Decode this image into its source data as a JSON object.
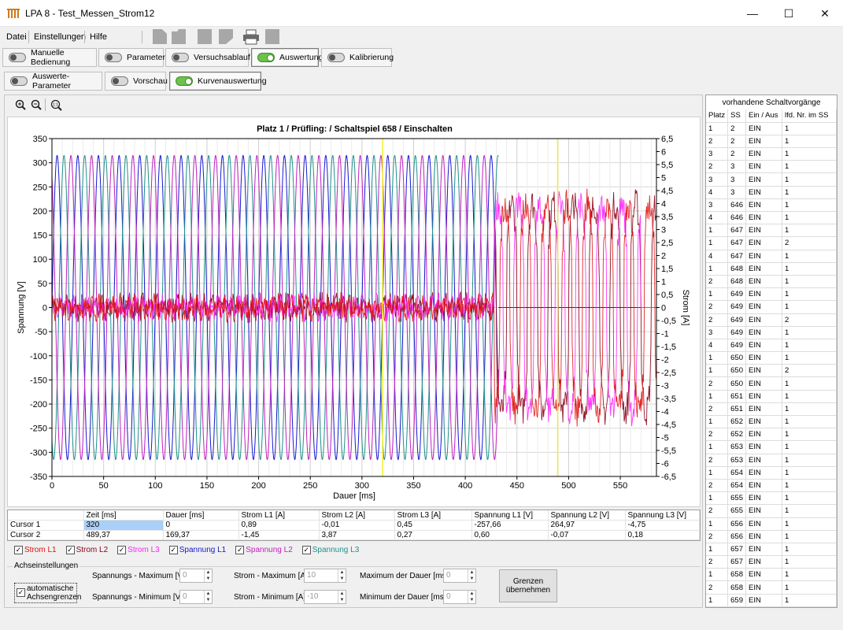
{
  "window": {
    "title": "LPA 8 - Test_Messen_Strom12"
  },
  "menu": {
    "items": [
      "Datei",
      "Einstellungen",
      "Hilfe"
    ]
  },
  "main_tabs": [
    {
      "label": "Manuelle Bedienung",
      "on": false
    },
    {
      "label": "Parameter",
      "on": false
    },
    {
      "label": "Versuchsablauf",
      "on": false
    },
    {
      "label": "Auswertung",
      "on": true
    },
    {
      "label": "Kalibrierung",
      "on": false
    }
  ],
  "sub_tabs": [
    {
      "label": "Auswerte-Parameter",
      "on": false
    },
    {
      "label": "Vorschau",
      "on": false
    },
    {
      "label": "Kurvenauswertung",
      "on": true
    }
  ],
  "colors": {
    "L1_strom": "#e01010",
    "L2_strom": "#8b0018",
    "L3_strom": "#ff22ff",
    "L1_span": "#1818d0",
    "L2_span": "#c020c0",
    "L3_span": "#20908a",
    "cursor": "#f0f020"
  },
  "chart_data": {
    "type": "line",
    "title": "Platz 1 / Prüfling:  / Schaltspiel 658 / Einschalten",
    "xlabel": "Dauer [ms]",
    "ylabel_left": "Spannung [V]",
    "ylabel_right": "Strom [A]",
    "xlim": [
      0,
      585
    ],
    "ylim_left": [
      -350,
      350
    ],
    "ylim_right": [
      -6.5,
      6.5
    ],
    "x_ticks": [
      0,
      50,
      100,
      150,
      200,
      250,
      300,
      350,
      400,
      450,
      500,
      550
    ],
    "y_ticks_left": [
      350,
      300,
      250,
      200,
      150,
      100,
      50,
      0,
      -50,
      -100,
      -150,
      -200,
      -250,
      -300,
      -350
    ],
    "y_ticks_right": [
      "6,5",
      "6",
      "5,5",
      "5",
      "4,5",
      "4",
      "3,5",
      "3",
      "2,5",
      "2",
      "1,5",
      "1",
      "0,5",
      "0",
      "-0,5",
      "-1",
      "-1,5",
      "-2",
      "-2,5",
      "-3",
      "-3,5",
      "-4",
      "-4,5",
      "-5",
      "-5,5",
      "-6",
      "-6,5"
    ],
    "voltage_amplitude_V": 315,
    "frequency_Hz": 50,
    "voltage_cutoff_ms": 432,
    "current_noise_amplitude_A": 0.5,
    "current_switch_on_ms": 428,
    "current_on_amplitude_A": 4.0,
    "cursors_ms": [
      320,
      489.37
    ],
    "grid": true,
    "series": [
      "Strom L1",
      "Strom L2",
      "Strom L3",
      "Spannung L1",
      "Spannung L2",
      "Spannung L3"
    ]
  },
  "cursor_table": {
    "headers": [
      "",
      "Zeit [ms]",
      "Dauer [ms]",
      "Strom L1 [A]",
      "Strom L2 [A]",
      "Strom L3 [A]",
      "Spannung L1 [V]",
      "Spannung L2 [V]",
      "Spannung L3 [V]"
    ],
    "rows": [
      [
        "Cursor 1",
        "320",
        "0",
        "0,89",
        "-0,01",
        "0,45",
        "-257,66",
        "264,97",
        "-4,75"
      ],
      [
        "Cursor 2",
        "489,37",
        "169,37",
        "-1,45",
        "3,87",
        "0,27",
        "0,60",
        "-0,07",
        "0,18"
      ]
    ]
  },
  "legend": [
    {
      "label": "Strom L1",
      "color": "#e01010",
      "checked": true
    },
    {
      "label": "Strom L2",
      "color": "#8b0018",
      "checked": true
    },
    {
      "label": "Strom L3",
      "color": "#ff22ff",
      "checked": true
    },
    {
      "label": "Spannung L1",
      "color": "#1818d0",
      "checked": true
    },
    {
      "label": "Spannung L2",
      "color": "#c020c0",
      "checked": true
    },
    {
      "label": "Spannung L3",
      "color": "#20908a",
      "checked": true
    }
  ],
  "axis_settings": {
    "title": "Achseinstellungen",
    "auto_label_1": "automatische",
    "auto_label_2": "Achsengrenzen",
    "auto_checked": true,
    "span_max_label": "Spannungs - Maximum [V]",
    "span_max_value": "0",
    "span_min_label": "Spannungs - Minimum [V]",
    "span_min_value": "0",
    "strom_max_label": "Strom - Maximum [A]",
    "strom_max_value": "10",
    "strom_min_label": "Strom - Minimum [A]",
    "strom_min_value": "-10",
    "dauer_max_label": "Maximum der Dauer [ms]",
    "dauer_max_value": "0",
    "dauer_min_label": "Minimum der Dauer [ms]",
    "dauer_min_value": "0",
    "button_line1": "Grenzen",
    "button_line2": "übernehmen"
  },
  "switch_list": {
    "title": "vorhandene Schaltvorgänge",
    "headers": [
      "Platz",
      "SS",
      "Ein / Aus",
      "lfd. Nr. im SS"
    ],
    "rows": [
      [
        "1",
        "2",
        "EIN",
        "1"
      ],
      [
        "2",
        "2",
        "EIN",
        "1"
      ],
      [
        "3",
        "2",
        "EIN",
        "1"
      ],
      [
        "2",
        "3",
        "EIN",
        "1"
      ],
      [
        "3",
        "3",
        "EIN",
        "1"
      ],
      [
        "4",
        "3",
        "EIN",
        "1"
      ],
      [
        "3",
        "646",
        "EIN",
        "1"
      ],
      [
        "4",
        "646",
        "EIN",
        "1"
      ],
      [
        "1",
        "647",
        "EIN",
        "1"
      ],
      [
        "1",
        "647",
        "EIN",
        "2"
      ],
      [
        "4",
        "647",
        "EIN",
        "1"
      ],
      [
        "1",
        "648",
        "EIN",
        "1"
      ],
      [
        "2",
        "648",
        "EIN",
        "1"
      ],
      [
        "1",
        "649",
        "EIN",
        "1"
      ],
      [
        "2",
        "649",
        "EIN",
        "1"
      ],
      [
        "2",
        "649",
        "EIN",
        "2"
      ],
      [
        "3",
        "649",
        "EIN",
        "1"
      ],
      [
        "4",
        "649",
        "EIN",
        "1"
      ],
      [
        "1",
        "650",
        "EIN",
        "1"
      ],
      [
        "1",
        "650",
        "EIN",
        "2"
      ],
      [
        "2",
        "650",
        "EIN",
        "1"
      ],
      [
        "1",
        "651",
        "EIN",
        "1"
      ],
      [
        "2",
        "651",
        "EIN",
        "1"
      ],
      [
        "1",
        "652",
        "EIN",
        "1"
      ],
      [
        "2",
        "652",
        "EIN",
        "1"
      ],
      [
        "1",
        "653",
        "EIN",
        "1"
      ],
      [
        "2",
        "653",
        "EIN",
        "1"
      ],
      [
        "1",
        "654",
        "EIN",
        "1"
      ],
      [
        "2",
        "654",
        "EIN",
        "1"
      ],
      [
        "1",
        "655",
        "EIN",
        "1"
      ],
      [
        "2",
        "655",
        "EIN",
        "1"
      ],
      [
        "1",
        "656",
        "EIN",
        "1"
      ],
      [
        "2",
        "656",
        "EIN",
        "1"
      ],
      [
        "1",
        "657",
        "EIN",
        "1"
      ],
      [
        "2",
        "657",
        "EIN",
        "1"
      ],
      [
        "1",
        "658",
        "EIN",
        "1"
      ],
      [
        "2",
        "658",
        "EIN",
        "1"
      ],
      [
        "1",
        "659",
        "EIN",
        "1"
      ]
    ]
  }
}
